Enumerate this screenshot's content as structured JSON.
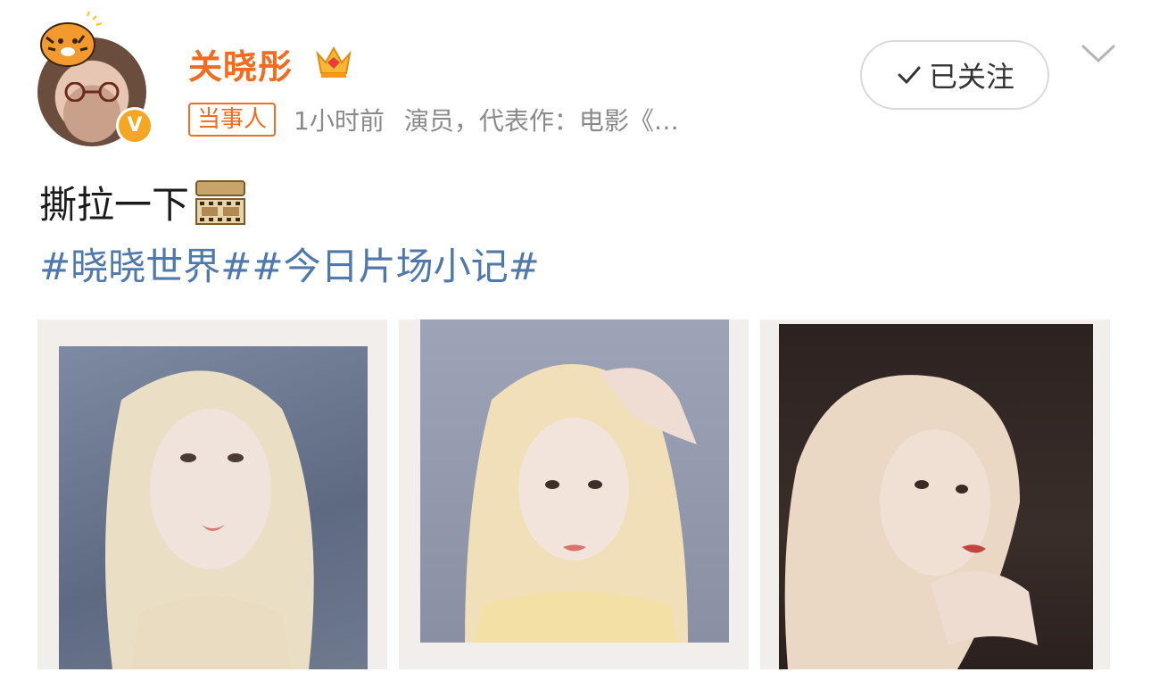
{
  "user": {
    "name": "关晓彤",
    "badge": "当事人",
    "time": "1小时前",
    "description": "演员，代表作：电影《…",
    "verified_mark": "V"
  },
  "follow": {
    "label": "已关注"
  },
  "post": {
    "text": "撕拉一下",
    "hashtags": [
      "#晓晓世界#",
      "#今日片场小记#"
    ]
  },
  "icons": [
    "tiger-sticker-icon",
    "crown-icon",
    "verified-v-icon",
    "check-icon",
    "chevron-down-icon",
    "film-icon"
  ],
  "colors": {
    "name": "#f26b1f",
    "hashtag": "#4f79ad",
    "verified": "#f5a623"
  }
}
